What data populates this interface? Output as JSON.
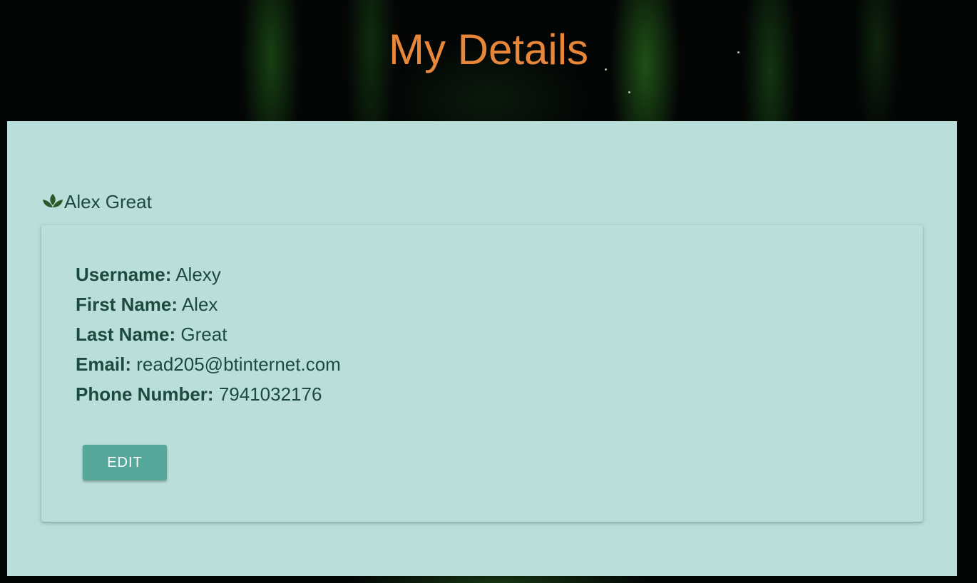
{
  "page": {
    "title": "My Details"
  },
  "profile": {
    "icon": "leaf-icon",
    "full_name": "Alex Great"
  },
  "details": [
    {
      "label": "Username:",
      "value": "Alexy"
    },
    {
      "label": "First Name:",
      "value": "Alex"
    },
    {
      "label": "Last Name:",
      "value": "Great"
    },
    {
      "label": "Email:",
      "value": "read205@btinternet.com"
    },
    {
      "label": "Phone Number:",
      "value": "7941032176"
    }
  ],
  "actions": {
    "edit_label": "EDIT"
  },
  "colors": {
    "title": "#e8873a",
    "panel_background": "#badfdb",
    "text": "#1d4a3e",
    "button": "#56a89b",
    "icon": "#2d5a2a"
  }
}
